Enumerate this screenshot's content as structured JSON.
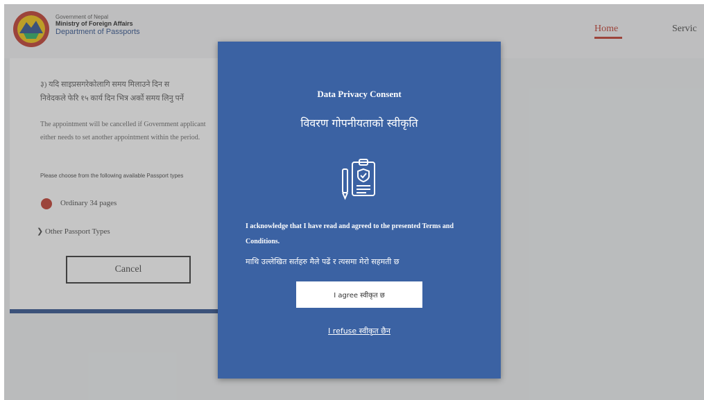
{
  "header": {
    "org_line1": "Government of Nepal",
    "org_line2": "Ministry of Foreign Affairs",
    "org_line3": "Department of Passports",
    "nav": {
      "home": "Home",
      "services": "Servic"
    }
  },
  "page": {
    "nepali_notice_line1": "३) यदि साइप्रसगरेकोलागि समय मिलाउने दिन स",
    "nepali_notice_line2": "निवेदकले फेरि १५ कार्य दिन भित्र अर्को समय लिनु पर्ने",
    "english_notice": "The appointment will be cancelled if Government applicant either needs to set another appointment within the period.",
    "choose_text": "Please choose from the following available Passport types",
    "passport_option": "Ordinary 34 pages",
    "other_types": "Other Passport Types",
    "cancel_label": "Cancel"
  },
  "modal": {
    "title": "Data Privacy Consent",
    "subtitle_np": "विवरण गोपनीयताको स्वीकृति",
    "acknowledge_en": "I acknowledge that I have read and agreed to the presented Terms and Conditions.",
    "acknowledge_np": "माथि उल्लेखित सर्तहरु मैले पढें र त्यसमा मेरो सहमती छ",
    "agree_label": "I agree स्वीकृत छ",
    "refuse_label": "I refuse स्वीकृत छैन"
  },
  "colors": {
    "modal_bg": "#3b62a3",
    "accent_red": "#c0392b",
    "brand_blue": "#2d4f8c"
  },
  "icons": {
    "logo": "nepal-emblem",
    "consent_icon": "clipboard-shield-pen-icon",
    "other_types_chevron": "chevron-right-icon"
  }
}
